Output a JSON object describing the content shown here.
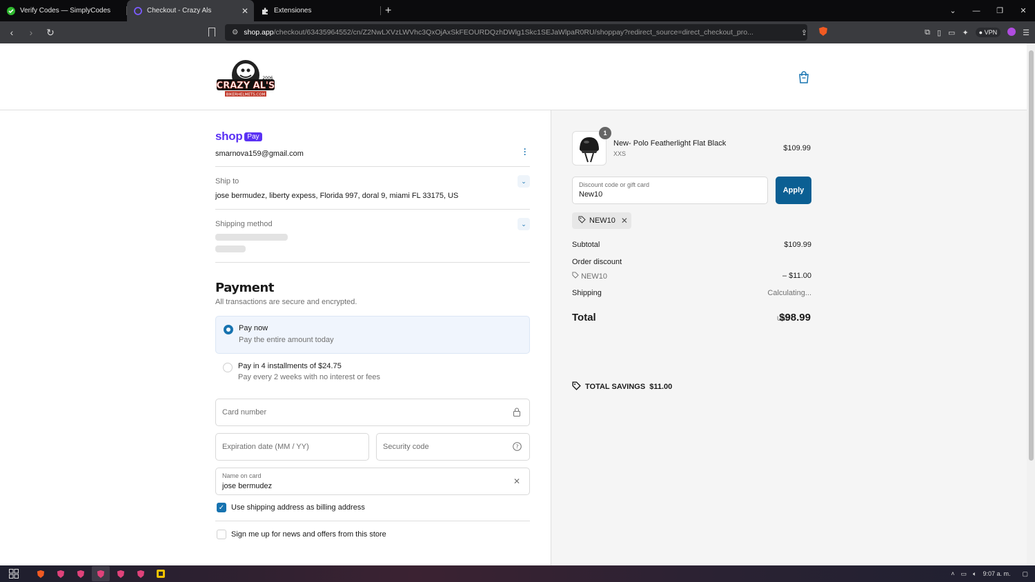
{
  "browser": {
    "tabs": [
      {
        "title": "Verify Codes — SimplyCodes",
        "active": false
      },
      {
        "title": "Checkout - Crazy Als",
        "active": true
      },
      {
        "title": "Extensiones",
        "active": false
      }
    ],
    "url_host": "shop.app",
    "url_path": "/checkout/63435964552/cn/Z2NwLXVzLWVhc3QxOjAxSkFEOURDQzhDWlg1Skc1SEJaWlpaR0RU/shoppay?redirect_source=direct_checkout_pro...",
    "vpn_label": "VPN",
    "shield_badge": "9"
  },
  "header": {
    "logo_text_top": "CRAZY AL'S",
    "logo_text_bottom": "BIKERHELMETS.COM",
    "logo_year": "2006",
    "cart_icon": "shopping-bag-icon"
  },
  "checkout": {
    "shop_label": "shop",
    "pay_badge": "Pay",
    "email": "smarnova159@gmail.com",
    "ship_to_label": "Ship to",
    "ship_to_value": "jose bermudez, liberty expess, Florida 997, doral 9, miami FL 33175, US",
    "shipping_method_label": "Shipping method",
    "payment_title": "Payment",
    "payment_subtitle": "All transactions are secure and encrypted.",
    "options": [
      {
        "title": "Pay now",
        "desc": "Pay the entire amount today",
        "selected": true
      },
      {
        "title": "Pay in 4 installments of $24.75",
        "desc": "Pay every 2 weeks with no interest or fees",
        "selected": false
      }
    ],
    "card_number_placeholder": "Card number",
    "expiration_placeholder": "Expiration date (MM / YY)",
    "security_placeholder": "Security code",
    "name_label": "Name on card",
    "name_value": "jose bermudez",
    "billing_checkbox_label": "Use shipping address as billing address",
    "billing_checked": true,
    "news_checkbox_label": "Sign me up for news and offers from this store",
    "news_checked": false
  },
  "summary": {
    "quantity": "1",
    "product_name": "New- Polo Featherlight Flat Black",
    "product_variant": "XXS",
    "product_price": "$109.99",
    "discount_label": "Discount code or gift card",
    "discount_value": "New10",
    "apply_label": "Apply",
    "applied_code": "NEW10",
    "subtotal_label": "Subtotal",
    "subtotal_value": "$109.99",
    "order_discount_label": "Order discount",
    "discount_code_row": "NEW10",
    "discount_amount": "– $11.00",
    "shipping_label": "Shipping",
    "shipping_value": "Calculating...",
    "total_label": "Total",
    "total_currency": "USD",
    "total_value": "$98.99",
    "savings_label": "TOTAL SAVINGS",
    "savings_value": "$11.00"
  },
  "taskbar": {
    "time": "9:07 a. m."
  },
  "colors": {
    "accent": "#1773b0",
    "shop_purple": "#5a31f4",
    "apply_button": "#0b5f93"
  }
}
